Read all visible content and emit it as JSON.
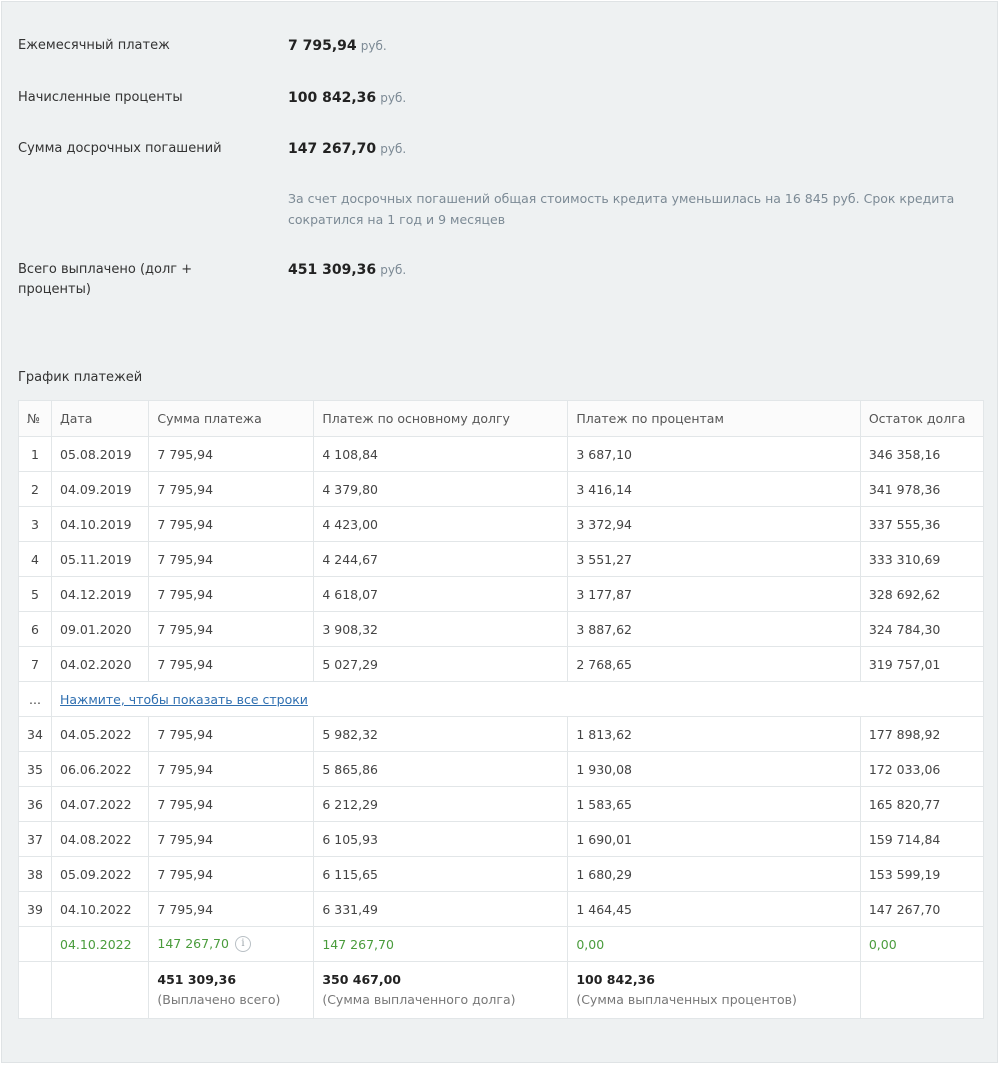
{
  "summary": {
    "monthly": {
      "label": "Ежемесячный платеж",
      "value": "7 795,94",
      "unit": "руб."
    },
    "interest": {
      "label": "Начисленные проценты",
      "value": "100 842,36",
      "unit": "руб."
    },
    "prepayments": {
      "label": "Сумма досрочных погашений",
      "value": "147 267,70",
      "unit": "руб."
    },
    "note": "За счет досрочных погашений общая стоимость кредита уменьшилась на 16 845 руб. Срок кредита сократился на 1 год и 9 месяцев",
    "total": {
      "label": "Всего выплачено (долг + проценты)",
      "value": "451 309,36",
      "unit": "руб."
    }
  },
  "schedule": {
    "title": "График платежей",
    "headers": [
      "№",
      "Дата",
      "Сумма платежа",
      "Платеж по основному долгу",
      "Платеж по процентам",
      "Остаток долга"
    ],
    "rows_top": [
      [
        "1",
        "05.08.2019",
        "7 795,94",
        "4 108,84",
        "3 687,10",
        "346 358,16"
      ],
      [
        "2",
        "04.09.2019",
        "7 795,94",
        "4 379,80",
        "3 416,14",
        "341 978,36"
      ],
      [
        "3",
        "04.10.2019",
        "7 795,94",
        "4 423,00",
        "3 372,94",
        "337 555,36"
      ],
      [
        "4",
        "05.11.2019",
        "7 795,94",
        "4 244,67",
        "3 551,27",
        "333 310,69"
      ],
      [
        "5",
        "04.12.2019",
        "7 795,94",
        "4 618,07",
        "3 177,87",
        "328 692,62"
      ],
      [
        "6",
        "09.01.2020",
        "7 795,94",
        "3 908,32",
        "3 887,62",
        "324 784,30"
      ],
      [
        "7",
        "04.02.2020",
        "7 795,94",
        "5 027,29",
        "2 768,65",
        "319 757,01"
      ]
    ],
    "collapsed": {
      "ellipsis": "...",
      "link": "Нажмите, чтобы показать все строки"
    },
    "rows_bottom": [
      [
        "34",
        "04.05.2022",
        "7 795,94",
        "5 982,32",
        "1 813,62",
        "177 898,92"
      ],
      [
        "35",
        "06.06.2022",
        "7 795,94",
        "5 865,86",
        "1 930,08",
        "172 033,06"
      ],
      [
        "36",
        "04.07.2022",
        "7 795,94",
        "6 212,29",
        "1 583,65",
        "165 820,77"
      ],
      [
        "37",
        "04.08.2022",
        "7 795,94",
        "6 105,93",
        "1 690,01",
        "159 714,84"
      ],
      [
        "38",
        "05.09.2022",
        "7 795,94",
        "6 115,65",
        "1 680,29",
        "153 599,19"
      ],
      [
        "39",
        "04.10.2022",
        "7 795,94",
        "6 331,49",
        "1 464,45",
        "147 267,70"
      ]
    ],
    "prepayment_row": {
      "num": "",
      "date": "04.10.2022",
      "amount": "147 267,70",
      "principal": "147 267,70",
      "interest": "0,00",
      "balance": "0,00",
      "info_icon": "info-icon",
      "info_glyph": "i"
    },
    "totals": {
      "paid_total": "451 309,36",
      "paid_total_label": "(Выплачено всего)",
      "principal_total": "350 467,00",
      "principal_total_label": "(Сумма выплаченного долга)",
      "interest_total": "100 842,36",
      "interest_total_label": "(Сумма выплаченных процентов)"
    },
    "colors": {
      "prepayment_row": "#4a9c3c",
      "link": "#2f6fb0"
    }
  }
}
